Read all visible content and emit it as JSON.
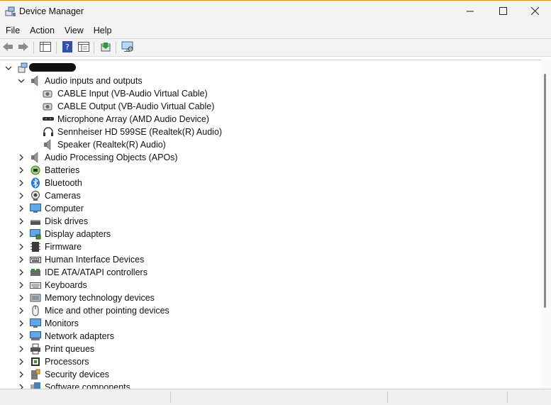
{
  "window": {
    "title": "Device Manager",
    "minimize_icon": "minimize-icon",
    "maximize_icon": "maximize-icon",
    "close_icon": "close-icon"
  },
  "menu": [
    "File",
    "Action",
    "View",
    "Help"
  ],
  "toolbar": {
    "icons": [
      "back-arrow-icon",
      "forward-arrow-icon",
      "show-hide-tree-icon",
      "help-icon",
      "properties-icon",
      "update-driver-icon",
      "scan-hardware-icon"
    ]
  },
  "tree": {
    "root": {
      "label": "",
      "redacted": true
    },
    "audio": {
      "label": "Audio inputs and outputs",
      "children": [
        "CABLE Input (VB-Audio Virtual Cable)",
        "CABLE Output (VB-Audio Virtual Cable)",
        "Microphone Array (AMD Audio Device)",
        "Sennheiser HD 599SE (Realtek(R) Audio)",
        "Speaker (Realtek(R) Audio)"
      ]
    },
    "categories": [
      "Audio Processing Objects (APOs)",
      "Batteries",
      "Bluetooth",
      "Cameras",
      "Computer",
      "Disk drives",
      "Display adapters",
      "Firmware",
      "Human Interface Devices",
      "IDE ATA/ATAPI controllers",
      "Keyboards",
      "Memory technology devices",
      "Mice and other pointing devices",
      "Monitors",
      "Network adapters",
      "Print queues",
      "Processors",
      "Security devices",
      "Software components"
    ]
  },
  "colors": {
    "accent": "#1e6fd9",
    "titlebar_bg": "#f3f3f3",
    "bluetooth": "#1f74e0",
    "green": "#3c9a3c"
  }
}
